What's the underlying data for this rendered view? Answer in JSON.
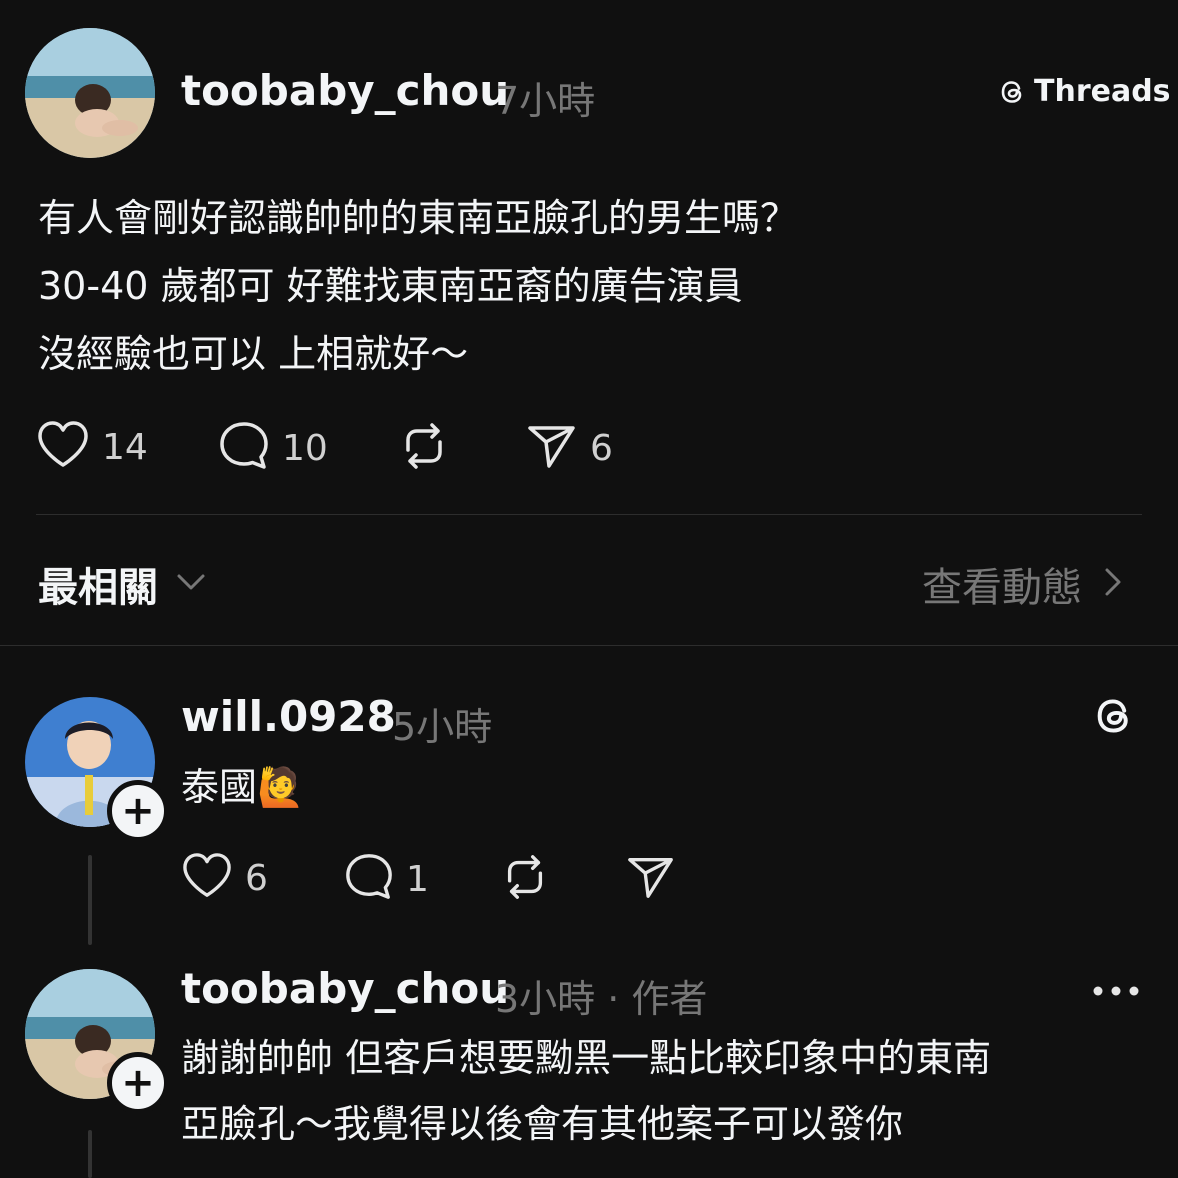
{
  "post": {
    "username": "toobaby_chou",
    "time": "7小時",
    "brand_label": "Threads",
    "text_lines": [
      "有人會剛好認識帥帥的東南亞臉孔的男生嗎？",
      "30-40 歲都可 好難找東南亞裔的廣告演員",
      "沒經驗也可以 上相就好～"
    ],
    "likes": "14",
    "comments": "10",
    "shares": "6"
  },
  "sort": {
    "label": "最相關",
    "activity_link": "查看動態"
  },
  "replies": [
    {
      "username": "will.0928",
      "time": "5小時",
      "text": "泰國🙋",
      "likes": "6",
      "comments": "1"
    },
    {
      "username": "toobaby_chou",
      "time": "3小時 · 作者",
      "text_lines": [
        "謝謝帥帥 但客戶想要黝黑一點比較印象中的東南",
        "亞臉孔～我覺得以後會有其他案子可以發你"
      ]
    }
  ],
  "colors": {
    "background": "#101010",
    "text": "#f3f5f7",
    "muted": "#777777",
    "divider": "#2d2d2d"
  }
}
